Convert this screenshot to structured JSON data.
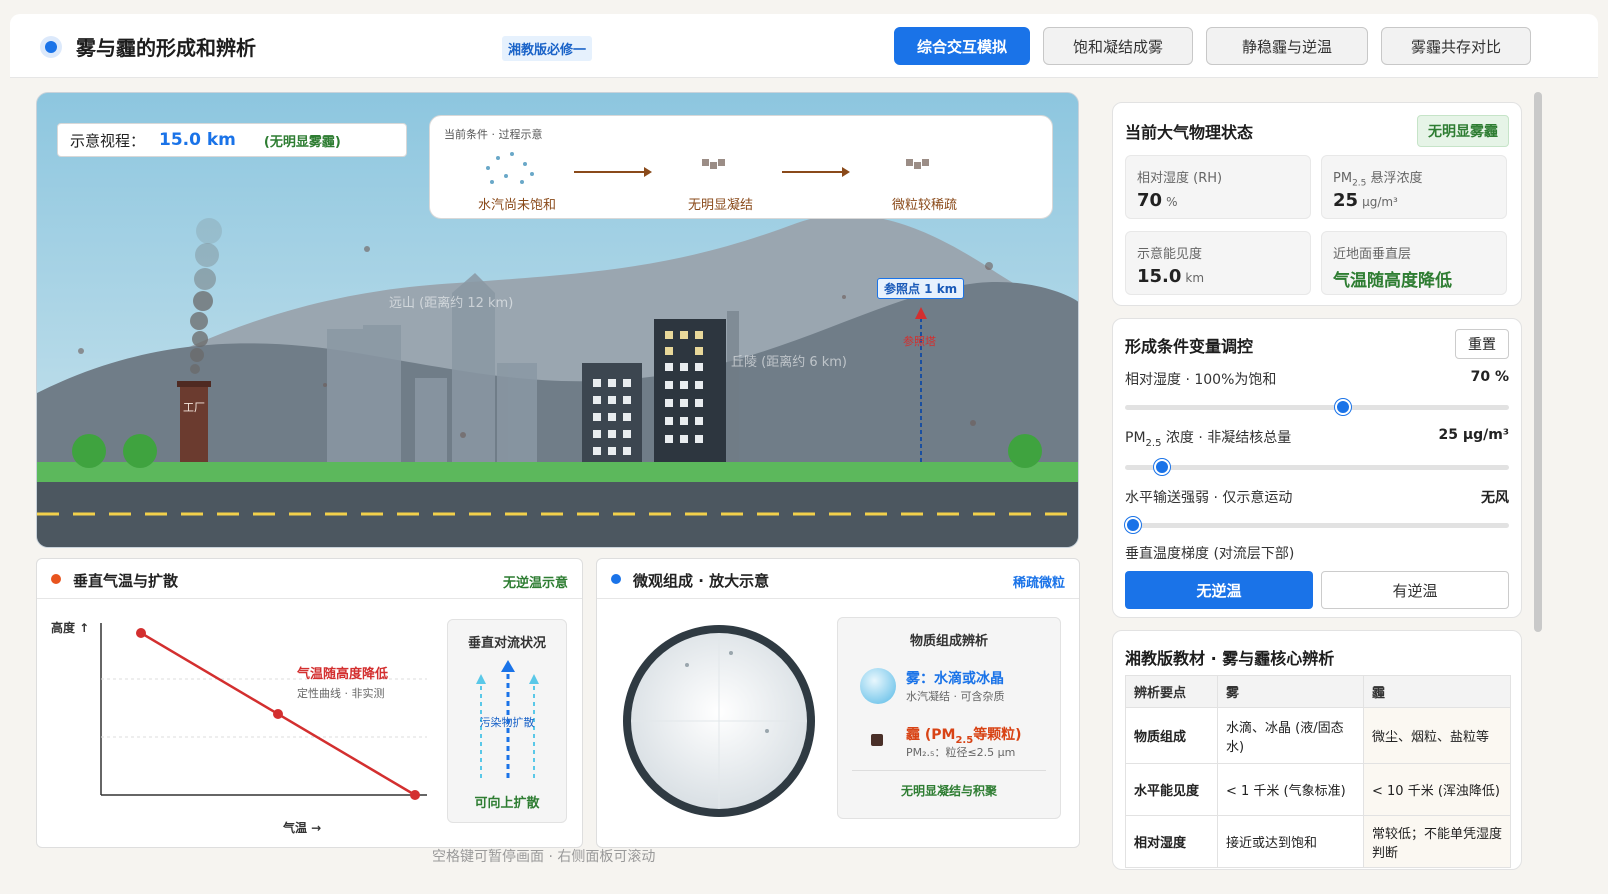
{
  "header": {
    "title": "雾与霾的形成和辨析",
    "badge": "湘教版必修一",
    "tabs": [
      {
        "label": "综合交互模拟",
        "active": true
      },
      {
        "label": "饱和凝结成雾",
        "active": false
      },
      {
        "label": "静稳霾与逆温",
        "active": false
      },
      {
        "label": "雾霾共存对比",
        "active": false
      }
    ]
  },
  "scene": {
    "visibility_label": "示意视程：",
    "visibility_value": "15.0 km",
    "visibility_status": "(无明显雾霾)",
    "process_title": "当前条件 · 过程示意",
    "steps": [
      "水汽尚未饱和",
      "无明显凝结",
      "微粒较稀疏"
    ],
    "far_mountain": "远山 (距离约 12 km)",
    "hill": "丘陵 (距离约 6 km)",
    "factory": "工厂",
    "ref_point": "参照点 1 km",
    "ref_tag": "参照塔"
  },
  "vertical_panel": {
    "title": "垂直气温与扩散",
    "status": "无逆温示意",
    "y_axis": "高度 ↑",
    "x_axis": "气温 →",
    "curve_label": "气温随高度降低",
    "curve_note": "定性曲线 · 非实测",
    "convection_title": "垂直对流状况",
    "convection_mid": "污染物扩散",
    "convection_bottom": "可向上扩散"
  },
  "micro_panel": {
    "title": "微观组成 · 放大示意",
    "status": "稀疏微粒",
    "legend_title": "物质组成辨析",
    "fog_label": "雾：水滴或冰晶",
    "fog_note": "水汽凝结 · 可含杂质",
    "haze_label_pre": "霾 (PM",
    "haze_sub": "2.5",
    "haze_label_post": "等颗粒)",
    "haze_note": "PM₂.₅：粒径≤2.5 μm",
    "legend_footer": "无明显凝结与积聚"
  },
  "state_card": {
    "title": "当前大气物理状态",
    "badge": "无明显雾霾",
    "rh_label": "相对湿度 (RH)",
    "rh_value": "70",
    "rh_unit": "%",
    "pm_label_pre": "PM",
    "pm_label_sub": "2.5",
    "pm_label_post": " 悬浮浓度",
    "pm_value": "25",
    "pm_unit": "μg/m³",
    "vis_label": "示意能见度",
    "vis_value": "15.0",
    "vis_unit": "km",
    "layer_label": "近地面垂直层",
    "layer_value": "气温随高度降低"
  },
  "controls": {
    "title": "形成条件变量调控",
    "reset": "重置",
    "rh_label": "相对湿度 · 100%为饱和",
    "rh_value": "70 %",
    "rh_level": 0.57,
    "pm_label_pre": "PM",
    "pm_label_sub": "2.5",
    "pm_label_post": " 浓度 · 非凝结核总量",
    "pm_value": "25 μg/m³",
    "pm_level": 0.08,
    "wind_label": "水平输送强弱 · 仅示意运动",
    "wind_value": "无风",
    "wind_level": 0.0,
    "gradient_label": "垂直温度梯度 (对流层下部)",
    "no_inversion": "无逆温",
    "inversion": "有逆温"
  },
  "textbook": {
    "title": "湘教版教材 · 雾与霾核心辨析",
    "headers": [
      "辨析要点",
      "雾",
      "霾"
    ],
    "rows": [
      [
        "物质组成",
        "水滴、冰晶 (液/固态水)",
        "微尘、烟粒、盐粒等"
      ],
      [
        "水平能见度",
        "< 1 千米 (气象标准)",
        "< 10 千米 (浑浊降低)"
      ],
      [
        "相对湿度",
        "接近或达到饱和",
        "常较低；不能单凭湿度判断"
      ]
    ]
  },
  "footer": "空格键可暂停画面 · 右侧面板可滚动",
  "colors": {
    "accent": "#1a73e8",
    "good": "#2e7d32",
    "warn": "#d32f2f",
    "brown": "#8a4a1a"
  }
}
